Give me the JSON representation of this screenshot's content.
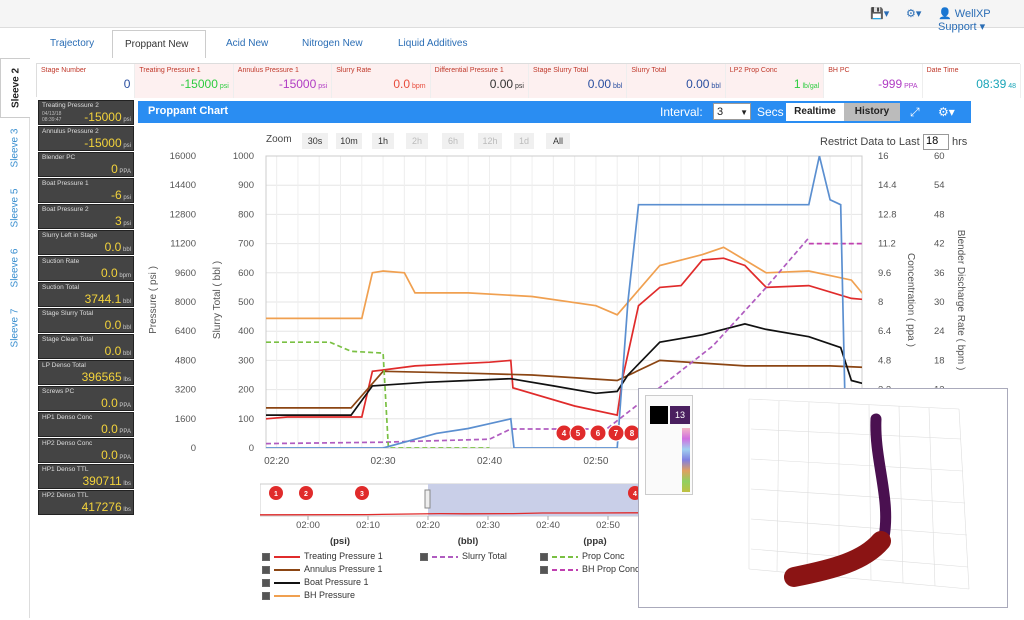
{
  "topbar": {
    "user": "WellXP Support"
  },
  "vtabs": [
    "Sleeve 2",
    "Sleeve 3",
    "Sleeve 5",
    "Sleeve 6",
    "Sleeve 7"
  ],
  "htabs": [
    "Trajectory",
    "Proppant New",
    "Acid New",
    "Nitrogen New",
    "Liquid Additives"
  ],
  "status": [
    {
      "label": "Stage Number",
      "value": "0",
      "unit": "",
      "color": "#2a4fa0"
    },
    {
      "label": "Treating Pressure 1",
      "value": "-15000",
      "unit": "psi",
      "color": "#2ecc40"
    },
    {
      "label": "Annulus Pressure 1",
      "value": "-15000",
      "unit": "psi",
      "color": "#b03cc4"
    },
    {
      "label": "Slurry Rate",
      "value": "0.0",
      "unit": "bpm",
      "color": "#e74c3c"
    },
    {
      "label": "Differential Pressure 1",
      "value": "0.00",
      "unit": "psi",
      "color": "#333333"
    },
    {
      "label": "Stage Slurry Total",
      "value": "0.00",
      "unit": "bbl",
      "color": "#2a4fa0"
    },
    {
      "label": "Slurry Total",
      "value": "0.00",
      "unit": "bbl",
      "color": "#2a4fa0"
    },
    {
      "label": "LP2 Prop Conc",
      "value": "1",
      "unit": "lb/gal",
      "color": "#2ecc40"
    },
    {
      "label": "BH PC",
      "value": "-999",
      "unit": "PPA",
      "color": "#b03cc4"
    },
    {
      "label": "Date Time",
      "value": "08:39",
      "unit": "48",
      "color": "#1aa5b8"
    }
  ],
  "left": [
    {
      "label": "Treating Pressure 2",
      "sub": "04/13/18 08:39:47",
      "value": "-15000",
      "unit": "psi"
    },
    {
      "label": "Annulus Pressure 2",
      "value": "-15000",
      "unit": "psi"
    },
    {
      "label": "Blender PC",
      "value": "0",
      "unit": "PPA"
    },
    {
      "label": "Boat Pressure 1",
      "value": "-6",
      "unit": "psi"
    },
    {
      "label": "Boat Pressure 2",
      "value": "3",
      "unit": "psi"
    },
    {
      "label": "Slurry Left in Stage",
      "value": "0.0",
      "unit": "bbl"
    },
    {
      "label": "Suction Rate",
      "value": "0.0",
      "unit": "bpm"
    },
    {
      "label": "Suction Total",
      "value": "3744.1",
      "unit": "bbl"
    },
    {
      "label": "Stage Slurry Total",
      "value": "0.0",
      "unit": "bbl"
    },
    {
      "label": "Stage Clean Total",
      "value": "0.0",
      "unit": "bbl"
    },
    {
      "label": "LP Denso Total",
      "value": "396565",
      "unit": "lbs"
    },
    {
      "label": "Screws PC",
      "value": "0.0",
      "unit": "PPA"
    },
    {
      "label": "HP1 Denso Conc",
      "value": "0.0",
      "unit": "PPA"
    },
    {
      "label": "HP2 Denso Conc",
      "value": "0.0",
      "unit": "PPA"
    },
    {
      "label": "HP1 Denso TTL",
      "value": "390711",
      "unit": "lbs"
    },
    {
      "label": "HP2 Denso TTL",
      "value": "417276",
      "unit": "lbs"
    }
  ],
  "chart": {
    "title": "Proppant Chart",
    "interval_label": "Interval:",
    "interval_value": "3",
    "secs_label": "Secs",
    "realtime_label": "Realtime",
    "history_label": "History",
    "zoom_label": "Zoom",
    "zoom_buttons": [
      "30s",
      "10m",
      "1h",
      "2h",
      "6h",
      "12h",
      "1d",
      "All"
    ],
    "restrict_label": "Restrict Data to Last",
    "restrict_value": "18",
    "restrict_unit": "hrs",
    "axis_pressure_label": "Pressure ( psi )",
    "axis_slurry_label": "Slurry Total ( bbl )",
    "axis_conc_label": "Concentration ( ppa )",
    "axis_rate_label": "Blender Discharge Rate ( bpm )",
    "nav_units": [
      "(psi)",
      "(bbl)",
      "(ppa)"
    ],
    "event_markers": [
      "4",
      "5",
      "6",
      "7",
      "8"
    ],
    "nav_markers": [
      "1",
      "2",
      "3",
      "4"
    ],
    "overlay_value": "13"
  },
  "legend": [
    {
      "label": "Treating Pressure 1",
      "color": "#e02b2b",
      "dash": false
    },
    {
      "label": "Annulus Pressure 1",
      "color": "#8b4513",
      "dash": false
    },
    {
      "label": "Boat Pressure 1",
      "color": "#111111",
      "dash": false
    },
    {
      "label": "BH Pressure",
      "color": "#f0a050",
      "dash": false
    },
    {
      "label": "Slurry Total",
      "color": "#b05cc0",
      "dash": true
    },
    {
      "label": "Prop Conc",
      "color": "#7ac043",
      "dash": true
    },
    {
      "label": "BH Prop Conc",
      "color": "#c040b0",
      "dash": true
    }
  ],
  "chart_data": {
    "type": "line",
    "x_ticks": [
      "02:20",
      "02:30",
      "02:40",
      "02:50",
      "03:00"
    ],
    "nav_ticks": [
      "02:00",
      "02:10",
      "02:20",
      "02:30",
      "02:40",
      "02:50"
    ],
    "x_range_minutes": [
      139,
      195
    ],
    "y_axes": {
      "pressure_psi": {
        "ticks": [
          0,
          1600,
          3200,
          4800,
          6400,
          8000,
          9600,
          11200,
          12800,
          14400,
          16000
        ],
        "range": [
          0,
          16000
        ]
      },
      "slurry_bbl": {
        "ticks": [
          0,
          100,
          200,
          300,
          400,
          500,
          600,
          700,
          800,
          900,
          1000
        ],
        "range": [
          0,
          1000
        ]
      },
      "conc_ppa": {
        "ticks": [
          3.2,
          4.8,
          6.4,
          8,
          9.6,
          11.2,
          12.8,
          14.4,
          16
        ],
        "range": [
          0,
          16
        ]
      },
      "rate_bpm": {
        "ticks": [
          6,
          12,
          18,
          24,
          30,
          36,
          42,
          48,
          54,
          60
        ],
        "range": [
          0,
          60
        ]
      }
    },
    "grid": true,
    "series": [
      {
        "name": "Treating Pressure 1",
        "axis": "pressure_psi",
        "color": "#e02b2b",
        "points": [
          [
            139,
            1600
          ],
          [
            141,
            1700
          ],
          [
            148,
            1700
          ],
          [
            149,
            4200
          ],
          [
            153,
            4500
          ],
          [
            160,
            4700
          ],
          [
            162,
            4800
          ],
          [
            162.2,
            3300
          ],
          [
            168,
            2300
          ],
          [
            172,
            1800
          ],
          [
            172.5,
            3800
          ],
          [
            174,
            7800
          ],
          [
            176,
            8800
          ],
          [
            178,
            8900
          ],
          [
            180,
            10300
          ],
          [
            182,
            10400
          ],
          [
            184,
            10000
          ],
          [
            186,
            8800
          ],
          [
            190,
            8900
          ],
          [
            194,
            8200
          ],
          [
            196,
            8100
          ]
        ]
      },
      {
        "name": "Annulus Pressure 1",
        "axis": "pressure_psi",
        "color": "#8b4513",
        "points": [
          [
            139,
            2200
          ],
          [
            147,
            2200
          ],
          [
            150,
            4200
          ],
          [
            158,
            4100
          ],
          [
            164,
            4000
          ],
          [
            172,
            3700
          ],
          [
            176,
            4800
          ],
          [
            184,
            4500
          ],
          [
            192,
            4500
          ],
          [
            196,
            4400
          ]
        ]
      },
      {
        "name": "Boat Pressure 1",
        "axis": "pressure_psi",
        "color": "#111111",
        "points": [
          [
            139,
            1800
          ],
          [
            147,
            1800
          ],
          [
            149,
            3400
          ],
          [
            154,
            3600
          ],
          [
            158,
            3700
          ],
          [
            162,
            3800
          ],
          [
            166,
            3400
          ],
          [
            170,
            3000
          ],
          [
            172,
            3100
          ],
          [
            173,
            4000
          ],
          [
            176,
            5800
          ],
          [
            180,
            6200
          ],
          [
            184,
            6800
          ],
          [
            186,
            6500
          ],
          [
            190,
            6100
          ],
          [
            193,
            5500
          ],
          [
            194,
            3700
          ],
          [
            196,
            3400
          ]
        ]
      },
      {
        "name": "BH Pressure",
        "axis": "pressure_psi",
        "color": "#f0a050",
        "points": [
          [
            139,
            7100
          ],
          [
            148,
            7100
          ],
          [
            149,
            9600
          ],
          [
            150,
            9700
          ],
          [
            152,
            9600
          ],
          [
            153,
            8500
          ],
          [
            158,
            8500
          ],
          [
            164,
            8300
          ],
          [
            170,
            7800
          ],
          [
            172,
            7300
          ],
          [
            176,
            10000
          ],
          [
            180,
            10600
          ],
          [
            182,
            11000
          ],
          [
            184,
            10300
          ],
          [
            186,
            9600
          ],
          [
            190,
            9700
          ],
          [
            194,
            9200
          ],
          [
            195,
            8500
          ],
          [
            196,
            8400
          ]
        ]
      },
      {
        "name": "Slurry Total",
        "axis": "slurry_bbl",
        "color": "#b05cc0",
        "dash": true,
        "points": [
          [
            139,
            15
          ],
          [
            150,
            20
          ],
          [
            160,
            30
          ],
          [
            162,
            65
          ],
          [
            171,
            65
          ],
          [
            181,
            350
          ],
          [
            186,
            550
          ],
          [
            190,
            720
          ]
        ]
      },
      {
        "name": "Prop Conc",
        "axis": "conc_ppa",
        "color": "#7ac043",
        "dash": true,
        "points": [
          [
            139,
            5.8
          ],
          [
            145,
            5.8
          ],
          [
            147,
            5.3
          ],
          [
            150,
            5.2
          ],
          [
            150.5,
            0
          ],
          [
            160,
            0
          ]
        ]
      },
      {
        "name": "BH Prop Conc",
        "axis": "conc_ppa",
        "color": "#c040b0",
        "dash": true,
        "points": [
          [
            190,
            11.2
          ],
          [
            196,
            11.2
          ]
        ]
      },
      {
        "name": "Blender Discharge Rate",
        "axis": "rate_bpm",
        "color": "#5b8fd0",
        "points": [
          [
            139,
            0
          ],
          [
            150,
            0
          ],
          [
            155,
            3
          ],
          [
            158,
            4
          ],
          [
            160,
            5
          ],
          [
            162,
            6
          ],
          [
            162.3,
            0
          ],
          [
            172,
            0
          ],
          [
            173,
            30
          ],
          [
            174,
            50
          ],
          [
            176,
            50
          ],
          [
            180,
            50
          ],
          [
            184,
            50
          ],
          [
            188,
            50
          ],
          [
            190,
            50
          ],
          [
            191,
            60
          ],
          [
            192,
            51
          ],
          [
            193,
            50
          ],
          [
            193.5,
            0
          ],
          [
            196,
            0
          ]
        ]
      }
    ]
  }
}
